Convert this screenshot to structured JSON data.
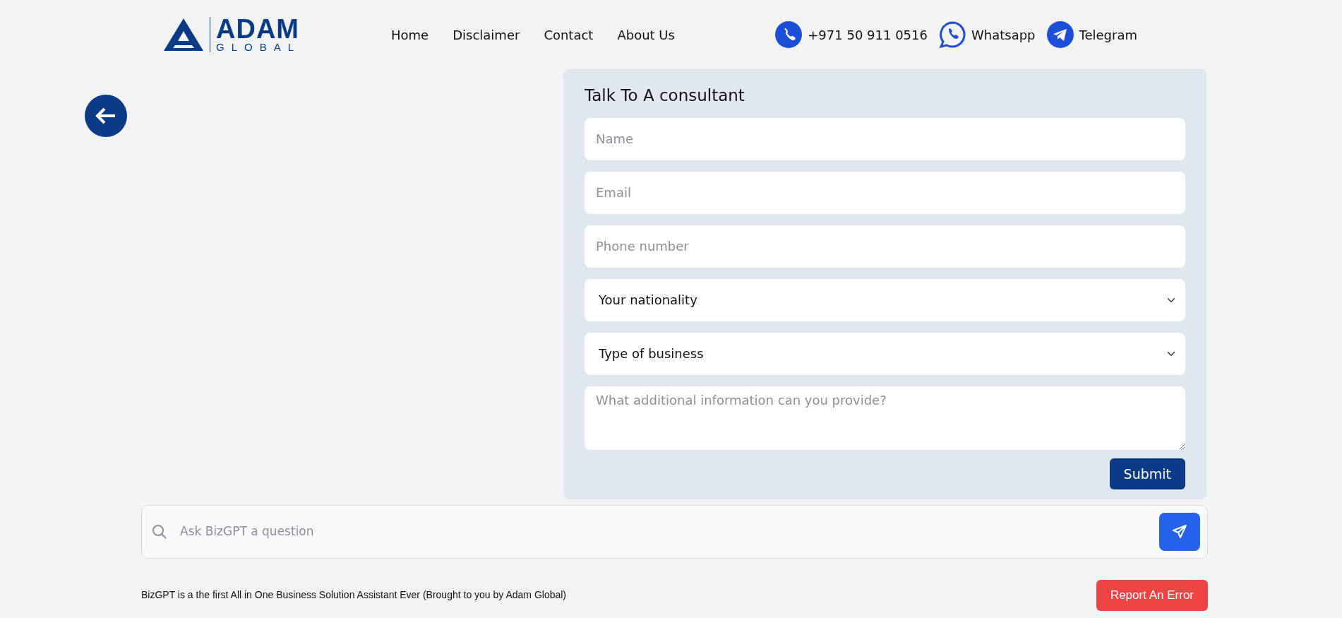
{
  "logo": {
    "word": "ADAM",
    "subword": "GLOBAL"
  },
  "nav": [
    {
      "label": "Home"
    },
    {
      "label": "Disclaimer"
    },
    {
      "label": "Contact"
    },
    {
      "label": "About Us"
    }
  ],
  "contacts": [
    {
      "kind": "phone",
      "label": "+971 50 911 0516"
    },
    {
      "kind": "whatsapp",
      "label": "Whatsapp"
    },
    {
      "kind": "telegram",
      "label": "Telegram"
    }
  ],
  "form": {
    "title": "Talk To A consultant",
    "fields": [
      {
        "kind": "input",
        "placeholder": "Name"
      },
      {
        "kind": "input",
        "placeholder": "Email"
      },
      {
        "kind": "input",
        "placeholder": "Phone number"
      },
      {
        "kind": "select",
        "value": "Your nationality"
      },
      {
        "kind": "select",
        "value": "Type of business"
      },
      {
        "kind": "textarea",
        "placeholder": "What additional information can you provide?"
      }
    ],
    "submit": "Submit"
  },
  "chat": {
    "placeholder": "Ask BizGPT a question"
  },
  "footer": {
    "text": "BizGPT is a the first All in One Business Solution Assistant Ever (Brought to you by Adam Global)",
    "report_button": "Report An Error"
  }
}
